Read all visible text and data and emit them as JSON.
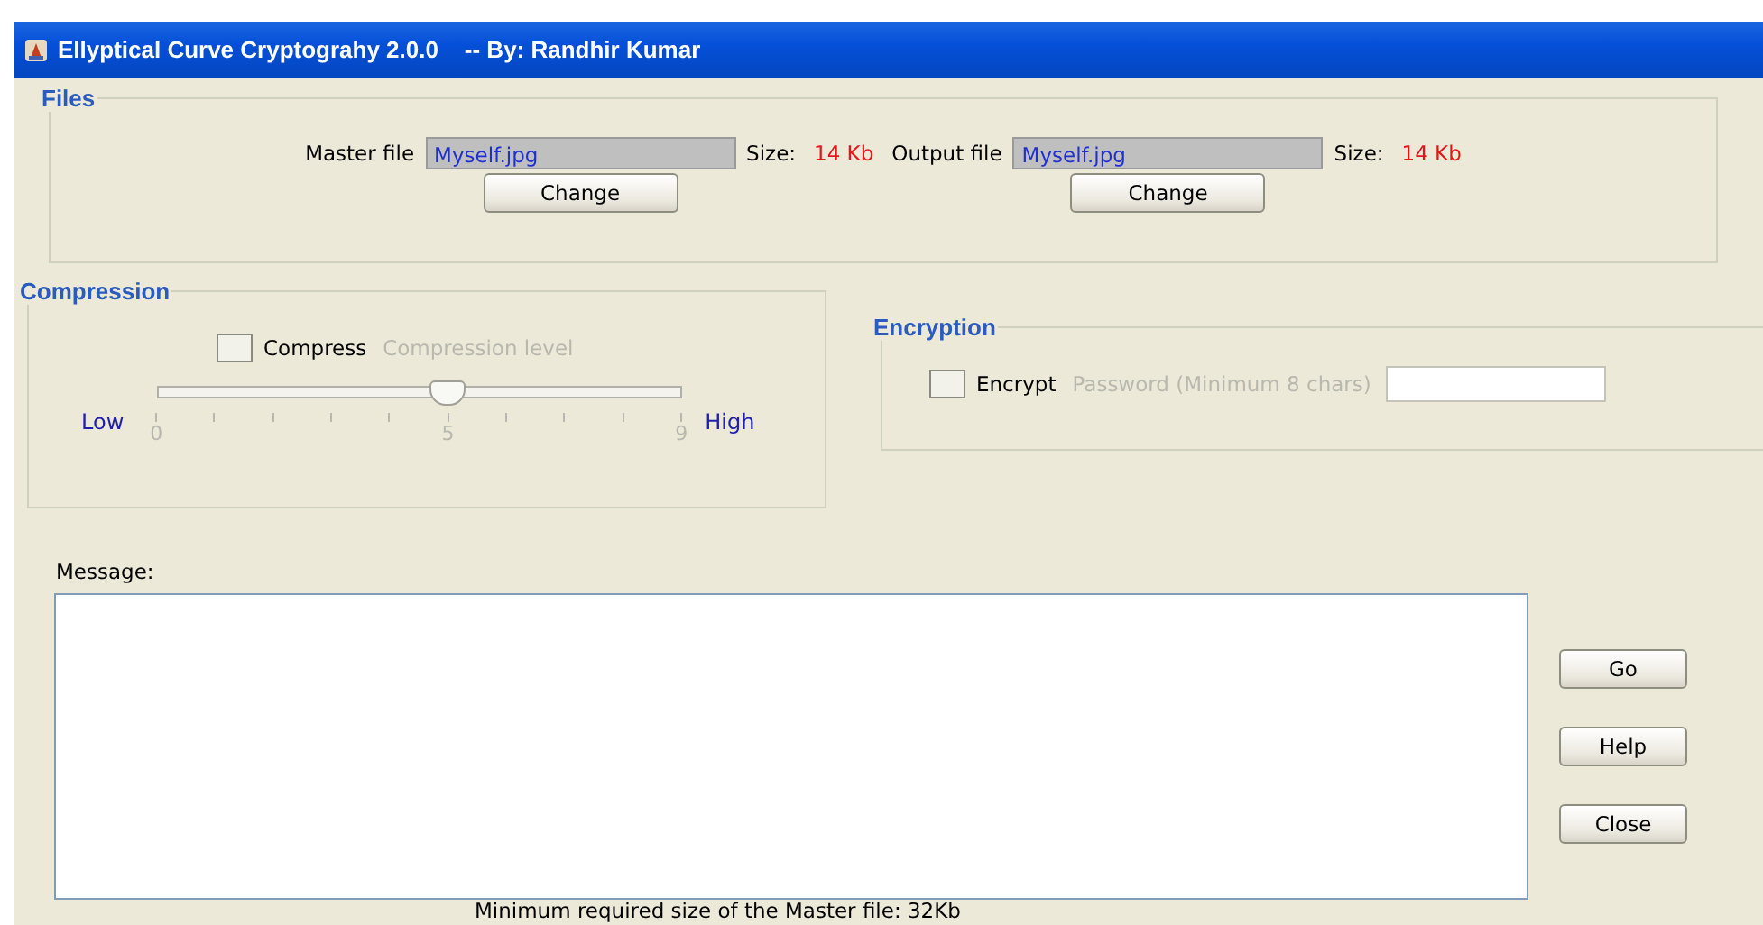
{
  "window": {
    "title": "Ellyptical Curve Cryptograhy 2.0.0    -- By: Randhir Kumar"
  },
  "files": {
    "title": "Files",
    "master": {
      "label": "Master file",
      "value": "Myself.jpg",
      "size_label": "Size:",
      "size": "14 Kb",
      "button": "Change"
    },
    "output": {
      "label": "Output file",
      "value": "Myself.jpg",
      "size_label": "Size:",
      "size": "14 Kb",
      "button": "Change"
    }
  },
  "compression": {
    "title": "Compression",
    "checkbox": {
      "label": "Compress",
      "checked": false
    },
    "level_label": {
      "text": "Compression level",
      "disabled": true
    },
    "slider": {
      "low": "Low",
      "high": "High",
      "level": 0.556,
      "disabled": true,
      "tick_labels": [
        "0",
        "5",
        "9"
      ]
    }
  },
  "encryption": {
    "title": "Encryption",
    "checkbox": {
      "label": "Encrypt",
      "checked": false
    },
    "password_label": {
      "text": "Password (Minimum 8 chars)",
      "disabled": true
    }
  },
  "message": {
    "label": "Message:"
  },
  "buttons": [
    "Go",
    "Help",
    "Close"
  ],
  "footer": "Minimum required size of the Master file: 32Kb"
}
